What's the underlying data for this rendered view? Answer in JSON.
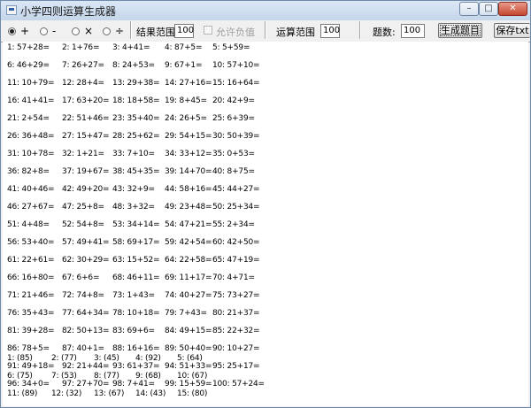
{
  "window": {
    "title": "小学四则运算生成器",
    "min": "–",
    "max": "□",
    "close": "✕"
  },
  "toolbar": {
    "ops": [
      {
        "label": "+",
        "selected": true
      },
      {
        "label": "-",
        "selected": false
      },
      {
        "label": "×",
        "selected": false
      },
      {
        "label": "÷",
        "selected": false
      }
    ],
    "result_range_label": "结果范围",
    "result_range_value": "100",
    "allow_negative_label": "允许负值",
    "operand_range_label": "运算范围",
    "operand_range_value": "100",
    "count_label": "题数:",
    "count_value": "100",
    "generate_button": "生成题目",
    "save_button": "保存txt"
  },
  "equations": [
    [
      "1: 57+28=",
      "2: 1+76=",
      "3: 4+41=",
      "4: 87+5=",
      "5: 5+59="
    ],
    [
      "6: 46+29=",
      "7: 26+27=",
      "8: 24+53=",
      "9: 67+1=",
      "10: 57+10="
    ],
    [
      "11: 10+79=",
      "12: 28+4=",
      "13: 29+38=",
      "14: 27+16=",
      "15: 16+64="
    ],
    [
      "16: 41+41=",
      "17: 63+20=",
      "18: 18+58=",
      "19: 8+45=",
      "20: 42+9="
    ],
    [
      "21: 2+54=",
      "22: 51+46=",
      "23: 35+40=",
      "24: 26+5=",
      "25: 6+39="
    ],
    [
      "26: 36+48=",
      "27: 15+47=",
      "28: 25+62=",
      "29: 54+15=",
      "30: 50+39="
    ],
    [
      "31: 10+78=",
      "32: 1+21=",
      "33: 7+10=",
      "34: 33+12=",
      "35: 0+53="
    ],
    [
      "36: 82+8=",
      "37: 19+67=",
      "38: 45+35=",
      "39: 14+70=",
      "40: 8+75="
    ],
    [
      "41: 40+46=",
      "42: 49+20=",
      "43: 32+9=",
      "44: 58+16=",
      "45: 44+27="
    ],
    [
      "46: 27+67=",
      "47: 25+8=",
      "48: 3+32=",
      "49: 23+48=",
      "50: 25+34="
    ],
    [
      "51: 4+48=",
      "52: 54+8=",
      "53: 34+14=",
      "54: 47+21=",
      "55: 2+34="
    ],
    [
      "56: 53+40=",
      "57: 49+41=",
      "58: 69+17=",
      "59: 42+54=",
      "60: 42+50="
    ],
    [
      "61: 22+61=",
      "62: 30+29=",
      "63: 15+52=",
      "64: 22+58=",
      "65: 47+19="
    ],
    [
      "66: 16+80=",
      "67: 6+6=",
      "68: 46+11=",
      "69: 11+17=",
      "70: 4+71="
    ],
    [
      "71: 21+46=",
      "72: 74+8=",
      "73: 1+43=",
      "74: 40+27=",
      "75: 73+27="
    ],
    [
      "76: 35+43=",
      "77: 64+34=",
      "78: 10+18=",
      "79: 7+43=",
      "80: 21+37="
    ],
    [
      "81: 39+28=",
      "82: 50+13=",
      "83: 69+6=",
      "84: 49+15=",
      "85: 22+32="
    ],
    [
      "86: 78+5=",
      "87: 40+1=",
      "88: 16+16=",
      "89: 50+40=",
      "90: 10+27="
    ],
    [
      "91: 49+18=",
      "92: 21+44=",
      "93: 61+37=",
      "94: 51+33=",
      "95: 25+17="
    ],
    [
      "96: 34+0=",
      "97: 27+70=",
      "98: 7+41=",
      "99: 15+59=",
      "100: 57+24="
    ]
  ],
  "answers": [
    [
      "1: (85)",
      "2: (77)",
      "3: (45)",
      "4: (92)",
      "5: (64)"
    ],
    [
      "6: (75)",
      "7: (53)",
      "8: (77)",
      "9: (68)",
      "10: (67)"
    ],
    [
      "11: (89)",
      "12: (32)",
      "13: (67)",
      "14: (43)",
      "15: (80)"
    ]
  ]
}
